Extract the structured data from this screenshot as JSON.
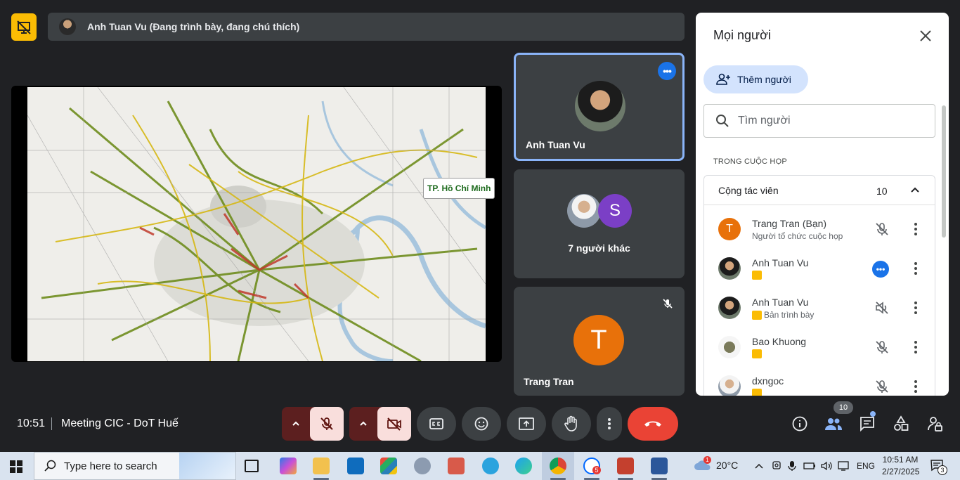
{
  "presenter_bar": {
    "text": "Anh Tuan Vu (Đang trình bày, đang chú thích)"
  },
  "presentation": {
    "map_label": "TP. Hồ Chí Minh"
  },
  "tiles": [
    {
      "name": "Anh Tuan Vu"
    },
    {
      "name": "7 người khác",
      "letter": "S"
    },
    {
      "name": "Trang Tran",
      "letter": "T"
    }
  ],
  "panel": {
    "title": "Mọi người",
    "add_label": "Thêm người",
    "search_placeholder": "Tìm người",
    "section_label": "TRONG CUỘC HỌP",
    "group_name": "Cộng tác viên",
    "group_count": "10",
    "people": [
      {
        "name": "Trang Tran (Bạn)",
        "sub": "Người tổ chức cuộc họp",
        "letter": "T"
      },
      {
        "name": "Anh Tuan Vu",
        "sub": ""
      },
      {
        "name": "Anh Tuan Vu",
        "sub": "Bản trình bày"
      },
      {
        "name": "Bao Khuong",
        "sub": ""
      },
      {
        "name": "dxngoc",
        "sub": ""
      }
    ]
  },
  "controls": {
    "time": "10:51",
    "meeting_title": "Meeting CIC - DoT Huế",
    "people_count": "10"
  },
  "taskbar": {
    "search_text": "Type here to search",
    "temperature": "20°C",
    "language": "ENG",
    "clock_time": "10:51 AM",
    "clock_date": "2/27/2025",
    "weather_badge": "1",
    "zalo_badge": "5",
    "notification_count": "3"
  },
  "colors": {
    "accent_blue": "#1a73e8",
    "hangup_red": "#ea4335",
    "present_yellow": "#fbbc04",
    "avatar_orange": "#e8710a",
    "avatar_purple": "#7b3fc6"
  }
}
